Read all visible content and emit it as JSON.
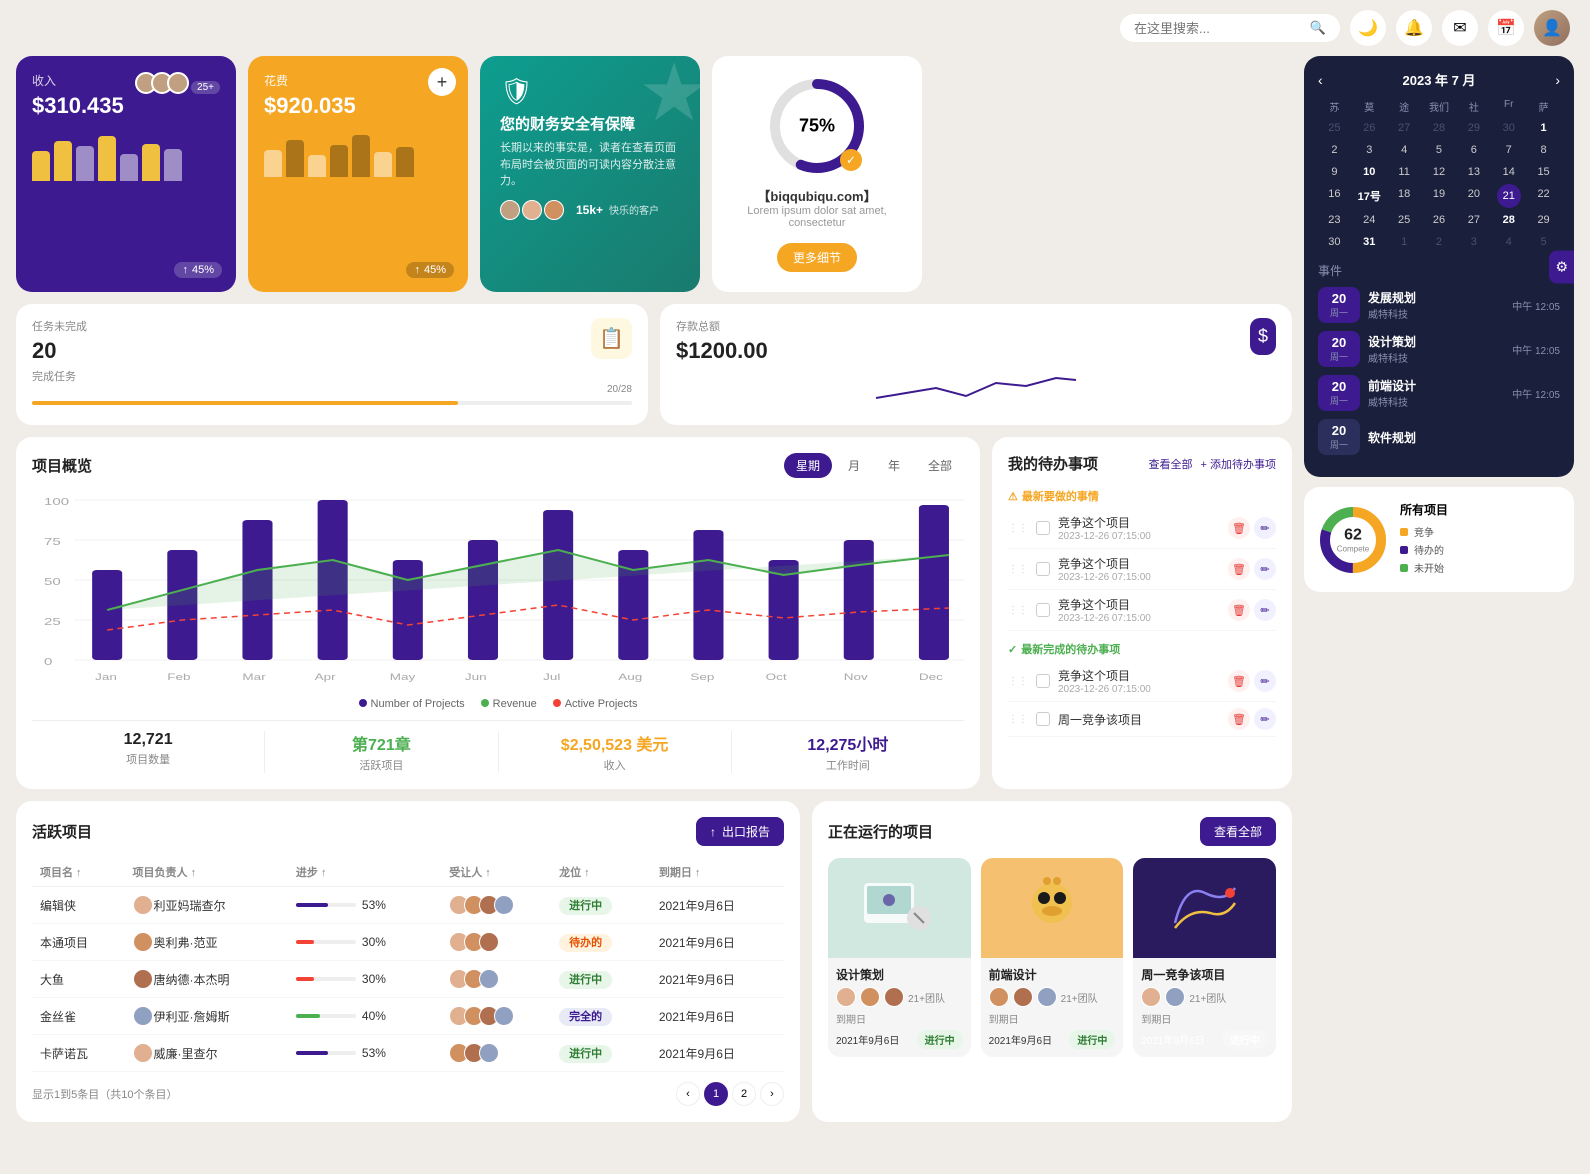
{
  "topbar": {
    "search_placeholder": "在这里搜索...",
    "icons": [
      "moon",
      "bell",
      "mail",
      "calendar",
      "user-avatar"
    ]
  },
  "revenue_card": {
    "label": "收入",
    "amount": "$310.435",
    "avatar_count": "25+",
    "pct": "45%",
    "bars": [
      40,
      60,
      55,
      70,
      45,
      65,
      50
    ]
  },
  "expense_card": {
    "label": "花费",
    "amount": "$920.035",
    "pct": "45%",
    "bars": [
      50,
      70,
      40,
      60,
      80,
      45,
      55
    ]
  },
  "promo_card": {
    "icon": "🛡",
    "title": "您的财务安全有保障",
    "desc": "长期以来的事实是，读者在查看页面布局时会被页面的可读内容分散注意力。",
    "customer_count": "15k+",
    "customer_label": "快乐的客户"
  },
  "circle_card": {
    "pct": 75,
    "pct_label": "75%",
    "domain": "【biqqubiqu.com】",
    "subdomain": "Lorem ipsum dolor sat amet, consectetur",
    "btn": "更多细节"
  },
  "task_card": {
    "label": "任务未完成",
    "value": "20",
    "sub": "完成任务",
    "progress": "20/28",
    "progress_pct": 71
  },
  "savings_card": {
    "label": "存款总额",
    "value": "$1200.00"
  },
  "overview": {
    "title": "项目概览",
    "tabs": [
      "星期",
      "月",
      "年",
      "全部"
    ],
    "active_tab": "星期",
    "months": [
      "Jan",
      "Feb",
      "Mar",
      "Apr",
      "May",
      "Jun",
      "Jul",
      "Aug",
      "Sep",
      "Oct",
      "Nov",
      "Dec"
    ],
    "legend": [
      {
        "color": "#3d1a8f",
        "label": "Number of Projects"
      },
      {
        "color": "#4caf50",
        "label": "Revenue"
      },
      {
        "color": "#f44336",
        "label": "Active Projects"
      }
    ],
    "stats": [
      {
        "value": "12,721",
        "label": "项目数量"
      },
      {
        "value": "第721章",
        "label": "活跃项目"
      },
      {
        "value": "$2,50,523 美元",
        "label": "收入"
      },
      {
        "value": "12,275小时",
        "label": "工作时间"
      }
    ]
  },
  "todo": {
    "title": "我的待办事项",
    "action1": "查看全部",
    "action2": "+ 添加待办事项",
    "sections": [
      {
        "label": "最新要做的事情",
        "icon": "⚠",
        "color": "orange",
        "items": [
          {
            "text": "竞争这个项目",
            "date": "2023-12-26 07:15:00"
          },
          {
            "text": "竞争这个项目",
            "date": "2023-12-26 07:15:00"
          },
          {
            "text": "竞争这个项目",
            "date": "2023-12-26 07:15:00"
          }
        ]
      },
      {
        "label": "最新完成的待办事项",
        "icon": "✓",
        "color": "green",
        "items": [
          {
            "text": "竞争这个项目",
            "date": "2023-12-26 07:15:00"
          },
          {
            "text": "周一竞争该项目",
            "date": ""
          }
        ]
      }
    ]
  },
  "active_projects": {
    "title": "活跃项目",
    "export_btn": "出口报告",
    "columns": [
      "项目名 ↑",
      "项目负责人 ↑",
      "进步 ↑",
      "受让人 ↑",
      "龙位 ↑",
      "到期日 ↑"
    ],
    "rows": [
      {
        "name": "编辑侠",
        "owner": "利亚妈瑞查尔",
        "progress": 53,
        "status": "进行中",
        "status_class": "active",
        "date": "2021年9月6日"
      },
      {
        "name": "本通项目",
        "owner": "奥利弗·范亚",
        "progress": 30,
        "status": "待办的",
        "status_class": "paused",
        "date": "2021年9月6日"
      },
      {
        "name": "大鱼",
        "owner": "唐纳德·本杰明",
        "progress": 30,
        "status": "进行中",
        "status_class": "active",
        "date": "2021年9月6日"
      },
      {
        "name": "金丝雀",
        "owner": "伊利亚·詹姆斯",
        "progress": 40,
        "status": "完全的",
        "status_class": "complete",
        "date": "2021年9月6日"
      },
      {
        "name": "卡萨诺瓦",
        "owner": "威廉·里查尔",
        "progress": 53,
        "status": "进行中",
        "status_class": "active",
        "date": "2021年9月6日"
      }
    ],
    "pagination_info": "显示1到5条目（共10个条目）",
    "pages": [
      1,
      2
    ]
  },
  "running_projects": {
    "title": "正在运行的项目",
    "view_all": "查看全部",
    "projects": [
      {
        "name": "设计策划",
        "team_count": "21+团队",
        "due": "2021年9月6日",
        "status": "进行中",
        "status_class": "active",
        "thumb_class": "project-thumb-1"
      },
      {
        "name": "前端设计",
        "team_count": "21+团队",
        "due": "2021年9月6日",
        "status": "进行中",
        "status_class": "active",
        "thumb_class": "project-thumb-2"
      },
      {
        "name": "周一竞争该项目",
        "team_count": "21+团队",
        "due": "2021年9月6日",
        "status": "进行中",
        "status_class": "active",
        "thumb_class": "project-thumb-3"
      }
    ]
  },
  "calendar": {
    "title": "2023 年 7 月",
    "day_labels": [
      "苏",
      "莫",
      "途",
      "我们",
      "社",
      "Fr",
      "萨"
    ],
    "prev": "‹",
    "next": "›",
    "events_title": "事件",
    "events": [
      {
        "date": "20",
        "day": "周一",
        "name": "发展规划",
        "org": "威特科技",
        "time": "中午 12:05"
      },
      {
        "date": "20",
        "day": "周一",
        "name": "设计策划",
        "org": "威特科技",
        "time": "中午 12:05"
      },
      {
        "date": "20",
        "day": "周一",
        "name": "前端设计",
        "org": "威特科技",
        "time": "中午 12:05"
      },
      {
        "date": "20",
        "day": "周一",
        "name": "软件规划",
        "org": "",
        "time": ""
      }
    ]
  },
  "donut": {
    "title": "所有项目",
    "center_num": "62",
    "center_lbl": "Compete",
    "legend": [
      {
        "color": "#f5a623",
        "label": "竞争"
      },
      {
        "color": "#3d1a8f",
        "label": "待办的"
      },
      {
        "color": "#4caf50",
        "label": "未开始"
      }
    ]
  }
}
